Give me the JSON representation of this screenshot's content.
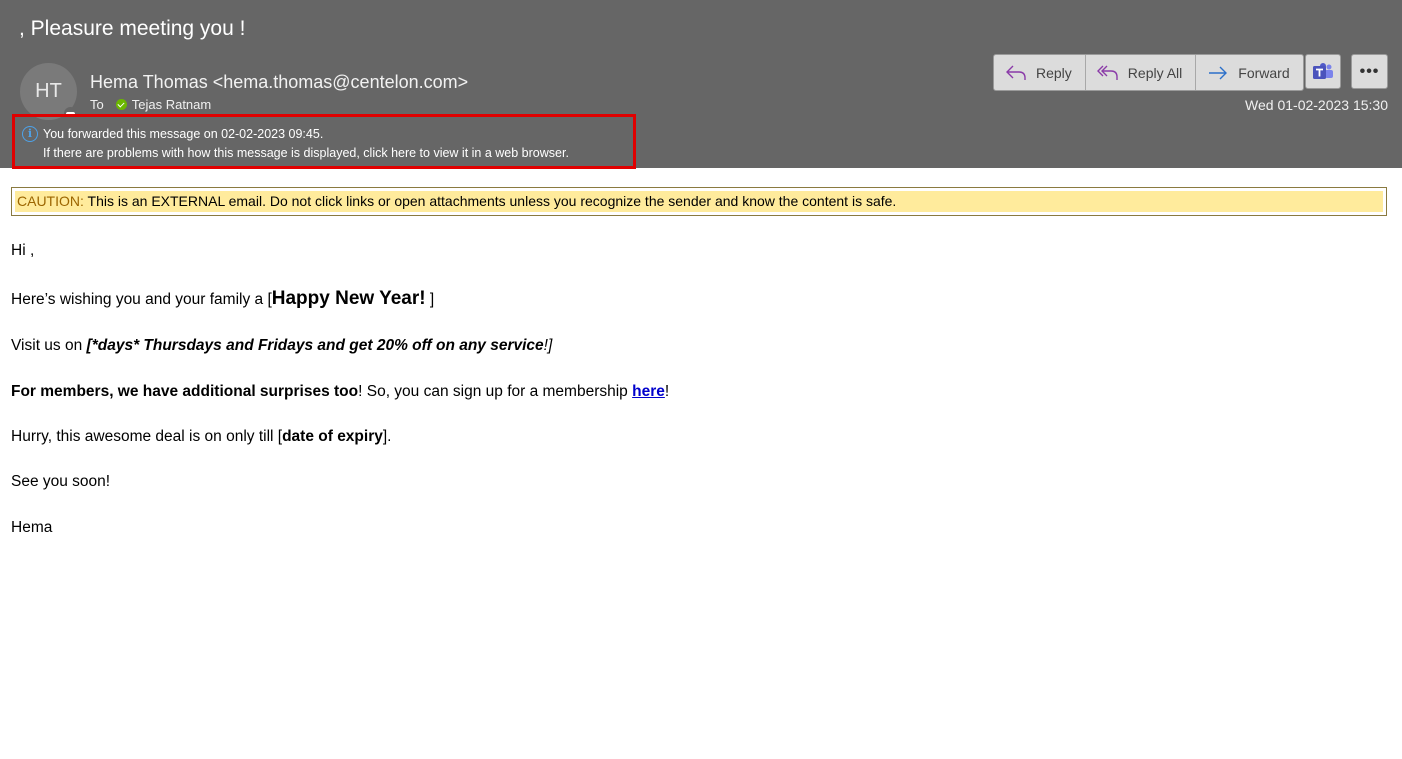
{
  "header": {
    "subject": ", Pleasure meeting you !",
    "avatar_initials": "HT",
    "sender": "Hema Thomas <hema.thomas@centelon.com>",
    "to_label": "To",
    "recipient": "Tejas Ratnam",
    "date": "Wed 01-02-2023 15:30",
    "info_line1": "You forwarded this message on 02-02-2023 09:45.",
    "info_line2": "If there are problems with how this message is displayed, click here to view it in a web browser."
  },
  "actions": {
    "reply": "Reply",
    "reply_all": "Reply All",
    "forward": "Forward",
    "more": "•••"
  },
  "caution": {
    "label": "CAUTION:",
    "text": " This is an EXTERNAL email. Do not click links or open attachments unless you recognize the sender and know the content is safe."
  },
  "body": {
    "greeting": "Hi ,",
    "line2_pre": "Here’s wishing you and your family a [",
    "line2_bold": "Happy New Year!",
    "line2_post": " ]",
    "line3_pre": "Visit us on ",
    "line3_italic": "[*days* Thursdays and Fridays and get 20% off on any service",
    "line3_post": "!]",
    "line4_bold": "For members, we have additional surprises too",
    "line4_mid": "! So, you can sign up for a membership ",
    "line4_link": "here",
    "line4_post": "!",
    "line5_pre": "Hurry, this awesome deal is on only till [",
    "line5_bold": "date of expiry",
    "line5_post": "].",
    "line6": "See you soon!",
    "signature": "Hema"
  },
  "colors": {
    "header_bg": "#666666",
    "highlight_border": "#e00000",
    "caution_bg": "#ffeb9c",
    "link": "#0000cc"
  }
}
